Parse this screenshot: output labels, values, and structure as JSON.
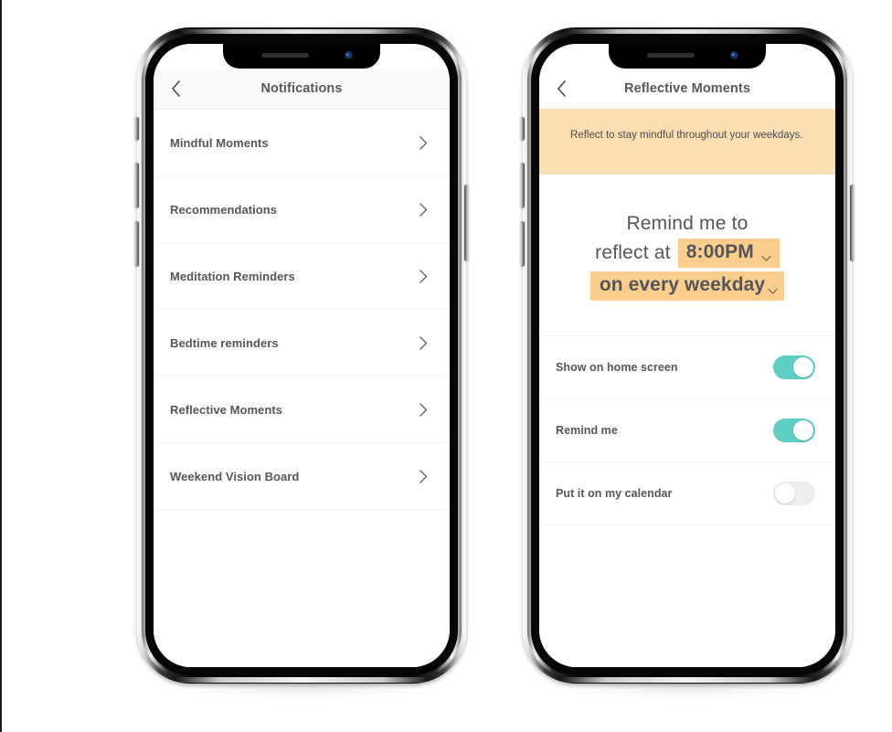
{
  "canvas": {
    "background": "#FFFFFF",
    "accent_teal": "#5FCFC5",
    "accent_orange_chip": "#FBCE8E",
    "accent_orange_banner": "#FBDFB3",
    "text_color": "#55565A"
  },
  "phones": [
    {
      "id": "notifications-screen",
      "header": {
        "title": "Notifications",
        "back_icon": "chevron-left-icon"
      },
      "list": {
        "items": [
          {
            "label": "Mindful Moments",
            "chevron": "chevron-right-icon"
          },
          {
            "label": "Recommendations",
            "chevron": "chevron-right-icon"
          },
          {
            "label": "Meditation Reminders",
            "chevron": "chevron-right-icon"
          },
          {
            "label": "Bedtime reminders",
            "chevron": "chevron-right-icon"
          },
          {
            "label": "Reflective Moments",
            "chevron": "chevron-right-icon"
          },
          {
            "label": "Weekend Vision Board",
            "chevron": "chevron-right-icon"
          }
        ]
      }
    },
    {
      "id": "reflective-moments-screen",
      "header": {
        "title": "Reflective Moments",
        "back_icon": "chevron-left-icon"
      },
      "banner": {
        "text": "Reflect to stay mindful throughout your weekdays."
      },
      "schedule": {
        "line1": "Remind me to",
        "line2_prefix": "reflect at",
        "time_value": "8:00PM",
        "time_caret": "chevron-down-icon",
        "repeat_value": "on every weekday",
        "repeat_caret": "chevron-down-icon"
      },
      "toggles": [
        {
          "label": "Show on home screen",
          "state": "on"
        },
        {
          "label": "Remind me",
          "state": "on"
        },
        {
          "label": "Put it on my calendar",
          "state": "off"
        }
      ]
    }
  ]
}
